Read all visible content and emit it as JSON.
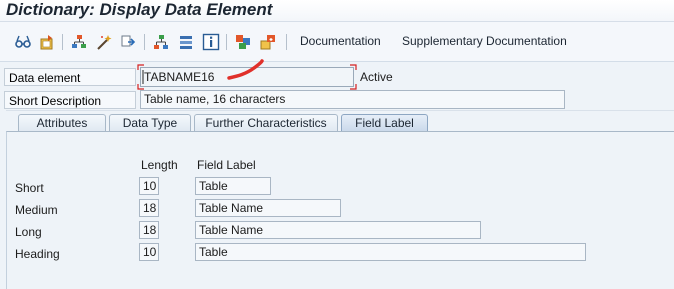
{
  "window": {
    "title": "Dictionary: Display Data Element"
  },
  "toolbar": {
    "icons": [
      "glasses-icon",
      "change-display-icon",
      "object-list-icon",
      "activate-icon",
      "where-used-icon",
      "hierarchy-icon",
      "navigate-icon",
      "info-icon",
      "multiple-objects-icon",
      "insert-icon"
    ],
    "documentation_label": "Documentation",
    "supplementary_label": "Supplementary Documentation"
  },
  "header": {
    "data_element_label": "Data element",
    "data_element_value": "TABNAME16",
    "status": "Active",
    "short_desc_label": "Short Description",
    "short_desc_value": "Table name, 16 characters"
  },
  "tabs": [
    {
      "label": "Attributes",
      "active": false
    },
    {
      "label": "Data Type",
      "active": false
    },
    {
      "label": "Further Characteristics",
      "active": false
    },
    {
      "label": "Field Label",
      "active": true
    }
  ],
  "field_label_tab": {
    "length_header": "Length",
    "label_header": "Field Label",
    "rows": [
      {
        "name": "Short",
        "length": "10",
        "label": "Table"
      },
      {
        "name": "Medium",
        "length": "18",
        "label": "Table Name"
      },
      {
        "name": "Long",
        "length": "18",
        "label": "Table Name"
      },
      {
        "name": "Heading",
        "length": "10",
        "label": "Table"
      }
    ]
  },
  "colors": {
    "annotation_red": "#e0302a",
    "focus_dash": "#d42020"
  }
}
